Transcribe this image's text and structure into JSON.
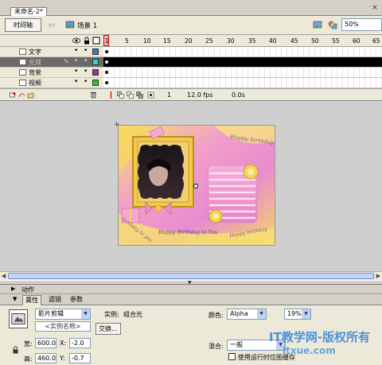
{
  "tab": {
    "title": "未命名-2*",
    "close": "×"
  },
  "editbar": {
    "timeline_button": "时间轴",
    "scene": "场景 1",
    "zoom": "50%"
  },
  "timeline": {
    "ruler": [
      "1",
      "5",
      "10",
      "15",
      "20",
      "25",
      "30",
      "35",
      "40",
      "45",
      "50",
      "55",
      "60",
      "65"
    ],
    "layers": [
      {
        "name": "文字",
        "color": "#2e7bd6",
        "selected": false
      },
      {
        "name": "光效",
        "color": "#38d0d0",
        "selected": true
      },
      {
        "name": "背景",
        "color": "#9a2ca8",
        "selected": false
      },
      {
        "name": "视频",
        "color": "#30c030",
        "selected": false
      }
    ],
    "vis_dot": "•",
    "lock_dot": "•",
    "footer": {
      "frame": "1",
      "fps": "12.0 fps",
      "time": "0.0s"
    }
  },
  "panels": {
    "actions": "动作",
    "properties_tabs": [
      "属性",
      "滤镜",
      "参数"
    ]
  },
  "properties": {
    "symbol_type": "影片剪辑",
    "instance_label": "实例:",
    "instance_of": "组合光",
    "instance_name_placeholder": "<实例名称>",
    "swap_button": "交换...",
    "width_label": "宽:",
    "width": "600.0",
    "height_label": "高:",
    "height": "460.0",
    "x_label": "X:",
    "x": "-2.0",
    "y_label": "Y:",
    "y": "-0.7",
    "color_label": "颜色:",
    "color_mode": "Alpha",
    "alpha": "19%",
    "blend_label": "混合:",
    "blend": "一般",
    "runtime_cache_label": "使用运行时位图缓存"
  },
  "artwork": {
    "text_happy_birthday": "Happy birthday",
    "text_birthday_to_you": "birthday to you",
    "text_script": "Happy Birthday to You"
  },
  "watermark": {
    "line1": "IT教学网-版权所有",
    "line2": "itxue.com"
  }
}
